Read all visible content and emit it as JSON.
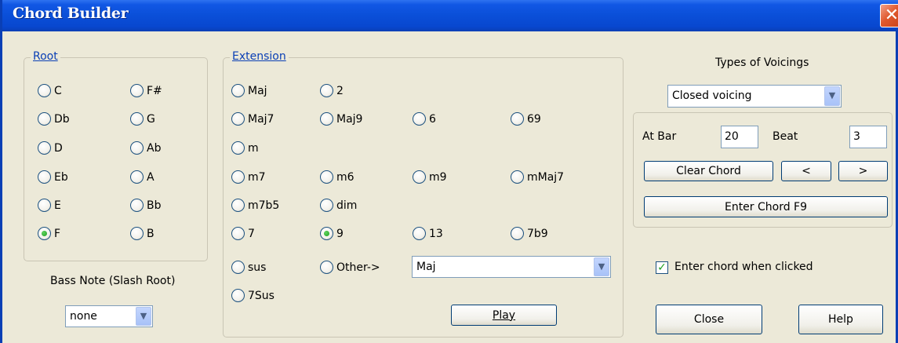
{
  "window": {
    "title": "Chord Builder",
    "close_glyph": "✕"
  },
  "root": {
    "legend": "Root",
    "options": [
      "C",
      "F#",
      "Db",
      "G",
      "D",
      "Ab",
      "Eb",
      "A",
      "E",
      "Bb",
      "F",
      "B"
    ],
    "selected": "F"
  },
  "bass": {
    "label": "Bass Note (Slash Root)",
    "value": "none"
  },
  "extension": {
    "legend": "Extension",
    "options": [
      "Maj",
      "2",
      "Maj7",
      "Maj9",
      "6",
      "69",
      "m",
      "m7",
      "m6",
      "m9",
      "mMaj7",
      "m7b5",
      "dim",
      "7",
      "9",
      "13",
      "7b9",
      "sus",
      "Other->",
      "7Sus"
    ],
    "selected": "9",
    "other_value": "Maj"
  },
  "play_label": "Play",
  "voicings": {
    "label": "Types of Voicings",
    "value": "Closed voicing"
  },
  "position": {
    "bar_label": "At Bar",
    "bar_value": "20",
    "beat_label": "Beat",
    "beat_value": "3"
  },
  "buttons": {
    "clear": "Clear Chord",
    "prev": "<",
    "next": ">",
    "enter": "Enter Chord F9",
    "close": "Close",
    "help": "Help"
  },
  "enter_when_clicked": {
    "label": "Enter chord when clicked",
    "checked": true
  },
  "icons": {
    "dropdown": "chevron-down-icon",
    "check": "checkmark-icon",
    "close": "close-icon"
  },
  "colors": {
    "titlebar": "#0a4fd8",
    "dialog": "#ece9d8",
    "legend": "#0a3fb5",
    "radio_selected": "#21a121"
  }
}
